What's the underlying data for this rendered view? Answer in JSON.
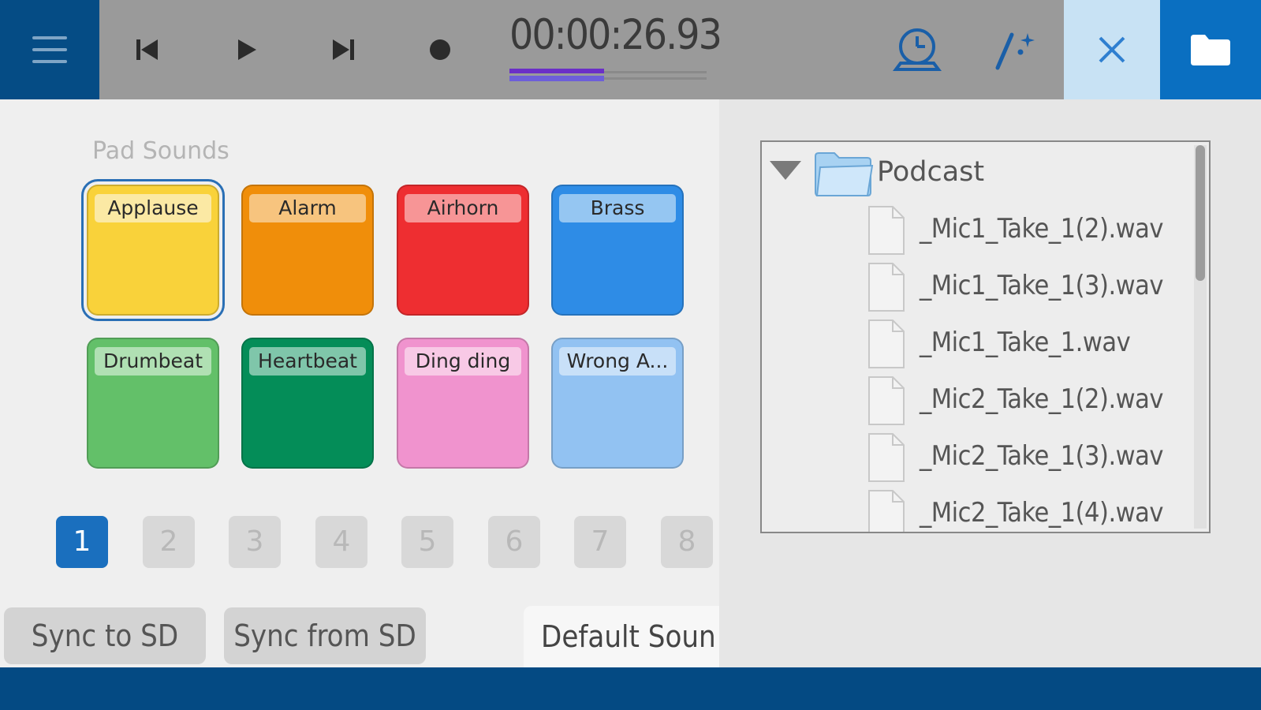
{
  "toolbar": {
    "menu_icon": "hamburger-icon",
    "transport": [
      {
        "name": "skip-back",
        "icon": "skip-back-icon"
      },
      {
        "name": "play",
        "icon": "play-icon"
      },
      {
        "name": "skip-forward",
        "icon": "skip-forward-icon"
      },
      {
        "name": "record",
        "icon": "record-icon"
      }
    ],
    "timer": "00:00:26.93",
    "progress_fraction": 0.48,
    "history_icon": "clock-icon",
    "effects_icon": "magic-wand-icon",
    "close_icon": "close-icon",
    "folder_icon": "folder-icon"
  },
  "pads": {
    "title": "Pad Sounds",
    "items": [
      {
        "label": "Applause",
        "color": "#f9d23a",
        "label_bg": "#fbe9a4",
        "selected": true
      },
      {
        "label": "Alarm",
        "color": "#f08e0a",
        "label_bg": "#f7c47e",
        "selected": false
      },
      {
        "label": "Airhorn",
        "color": "#ee2e31",
        "label_bg": "#f79596",
        "selected": false
      },
      {
        "label": "Brass",
        "color": "#2e8ce6",
        "label_bg": "#95c6f2",
        "selected": false
      },
      {
        "label": "Drumbeat",
        "color": "#63c069",
        "label_bg": "#b0e0b3",
        "selected": false
      },
      {
        "label": "Heartbeat",
        "color": "#048d58",
        "label_bg": "#7fc6aa",
        "selected": false
      },
      {
        "label": "Ding ding",
        "color": "#f093ce",
        "label_bg": "#f8c9e6",
        "selected": false
      },
      {
        "label": "Wrong A...",
        "color": "#92c2f2",
        "label_bg": "#c8e0f8",
        "selected": false
      }
    ]
  },
  "pages": {
    "items": [
      "1",
      "2",
      "3",
      "4",
      "5",
      "6",
      "7",
      "8"
    ],
    "active": "1"
  },
  "buttons": {
    "sync_to_sd": "Sync to SD",
    "sync_from_sd": "Sync from SD",
    "default_sounds": "Default Soun"
  },
  "file_tree": {
    "root": "Podcast",
    "files": [
      "_Mic1_Take_1(2).wav",
      "_Mic1_Take_1(3).wav",
      "_Mic1_Take_1.wav",
      "_Mic2_Take_1(2).wav",
      "_Mic2_Take_1(3).wav",
      "_Mic2_Take_1(4).wav"
    ]
  }
}
